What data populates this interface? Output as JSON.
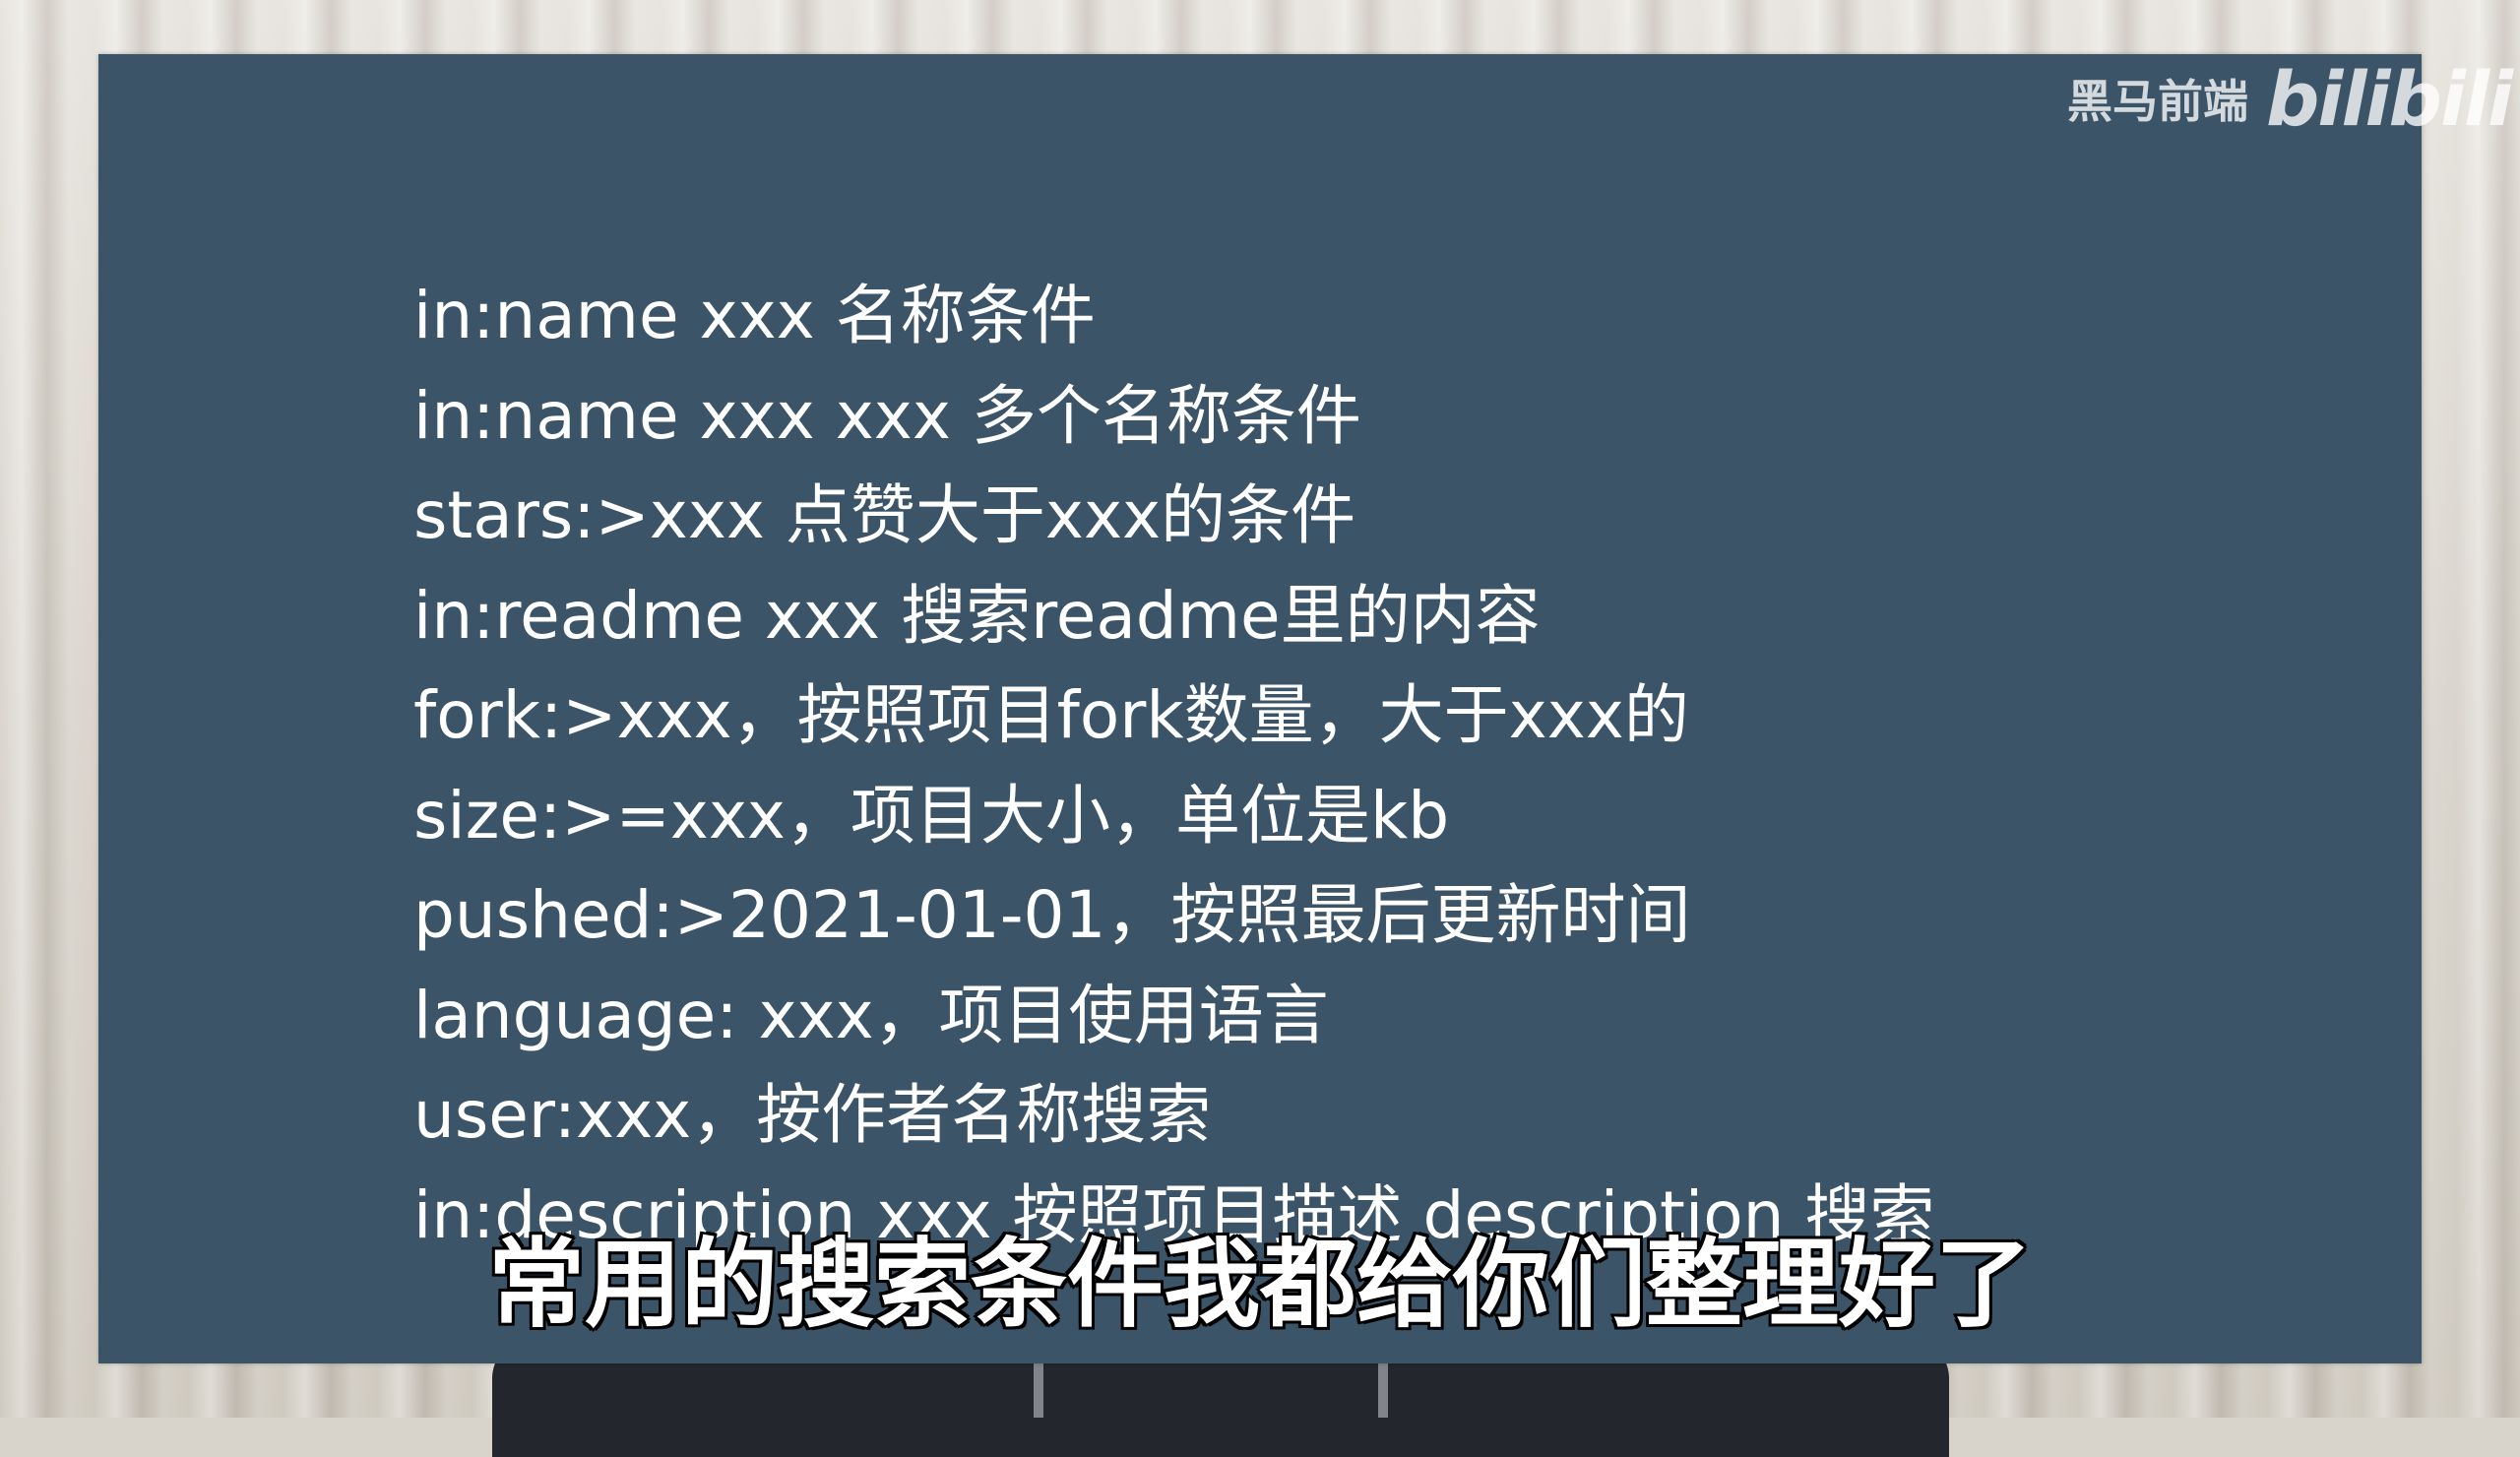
{
  "slide": {
    "lines": [
      "in:name xxx 名称条件",
      "in:name xxx xxx 多个名称条件",
      "stars:>xxx 点赞大于xxx的条件",
      "in:readme xxx 搜索readme里的内容",
      "fork:>xxx，按照项目fork数量，大于xxx的",
      "size:>=xxx，项目大小，单位是kb",
      "pushed:>2021-01-01，按照最后更新时间",
      "language: xxx，项目使用语言",
      "user:xxx，按作者名称搜索",
      "in:description xxx 按照项目描述 description 搜索"
    ]
  },
  "watermark": {
    "channel": "黑马前端",
    "logo": "bilibili"
  },
  "subtitle": {
    "text": "常用的搜索条件我都给你们整理好了"
  },
  "colors": {
    "slide_background": "#3b5468",
    "text": "#ffffff",
    "subtitle_outline": "#000000"
  }
}
